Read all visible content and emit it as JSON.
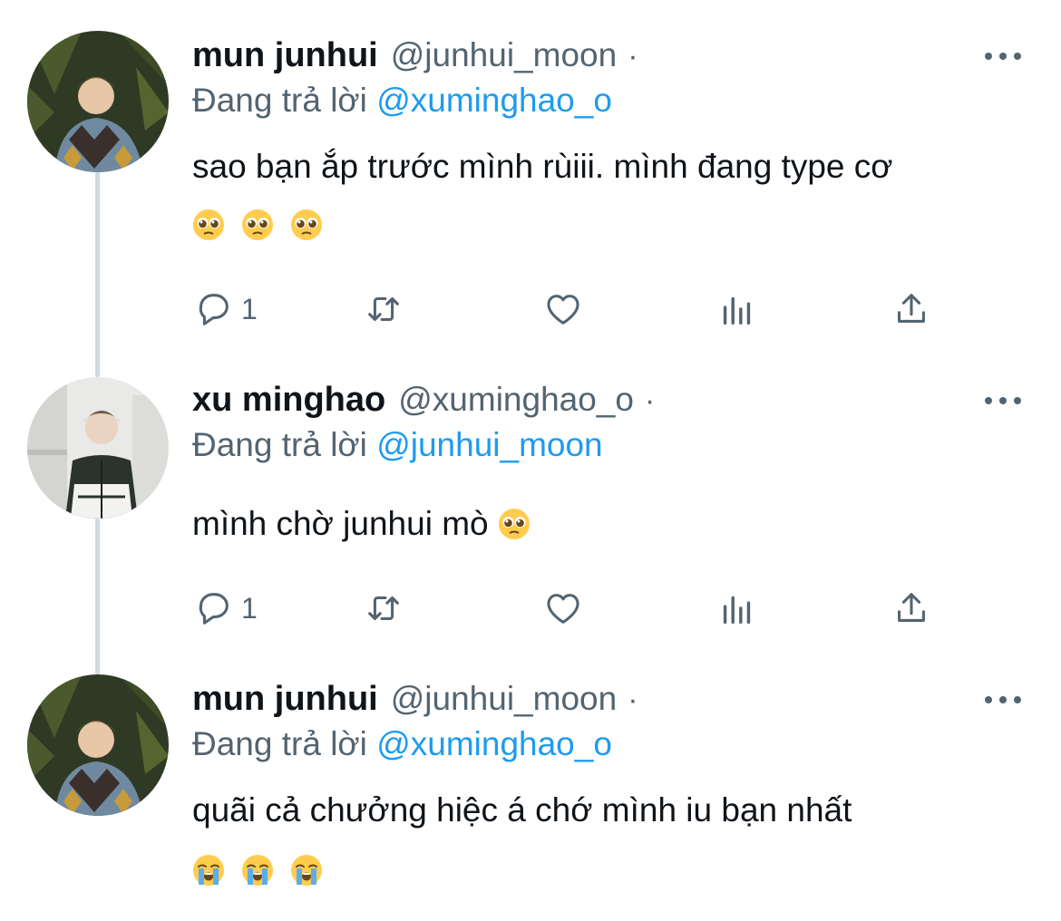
{
  "thread": [
    {
      "name": "mun junhui",
      "handle": "@junhui_moon",
      "dot": "·",
      "reply_prefix": "Đang trả lời",
      "reply_to": "@xuminghao_o",
      "text": "sao bạn ắp trước mình rùiii. mình đang type cơ",
      "emojis": [
        "pleading-face-emoji",
        "pleading-face-emoji",
        "pleading-face-emoji"
      ],
      "reply_count": "1"
    },
    {
      "name": "xu minghao",
      "handle": "@xuminghao_o",
      "dot": "·",
      "reply_prefix": "Đang trả lời",
      "reply_to": "@junhui_moon",
      "text": "mình chờ junhui mò",
      "emojis": [
        "pleading-face-emoji"
      ],
      "reply_count": "1"
    },
    {
      "name": "mun junhui",
      "handle": "@junhui_moon",
      "dot": "·",
      "reply_prefix": "Đang trả lời",
      "reply_to": "@xuminghao_o",
      "text": "quãi cả chưởng hiệc á chớ mình iu bạn nhất",
      "emojis": [
        "loudly-crying-face-emoji",
        "loudly-crying-face-emoji",
        "loudly-crying-face-emoji"
      ]
    }
  ],
  "icons": [
    "more-icon",
    "reply-icon",
    "retweet-icon",
    "like-icon",
    "analytics-icon",
    "share-icon"
  ],
  "colors": {
    "text": "#0f1419",
    "secondary": "#536471",
    "link": "#1d9bf0",
    "thread_line": "#cfd9de"
  }
}
